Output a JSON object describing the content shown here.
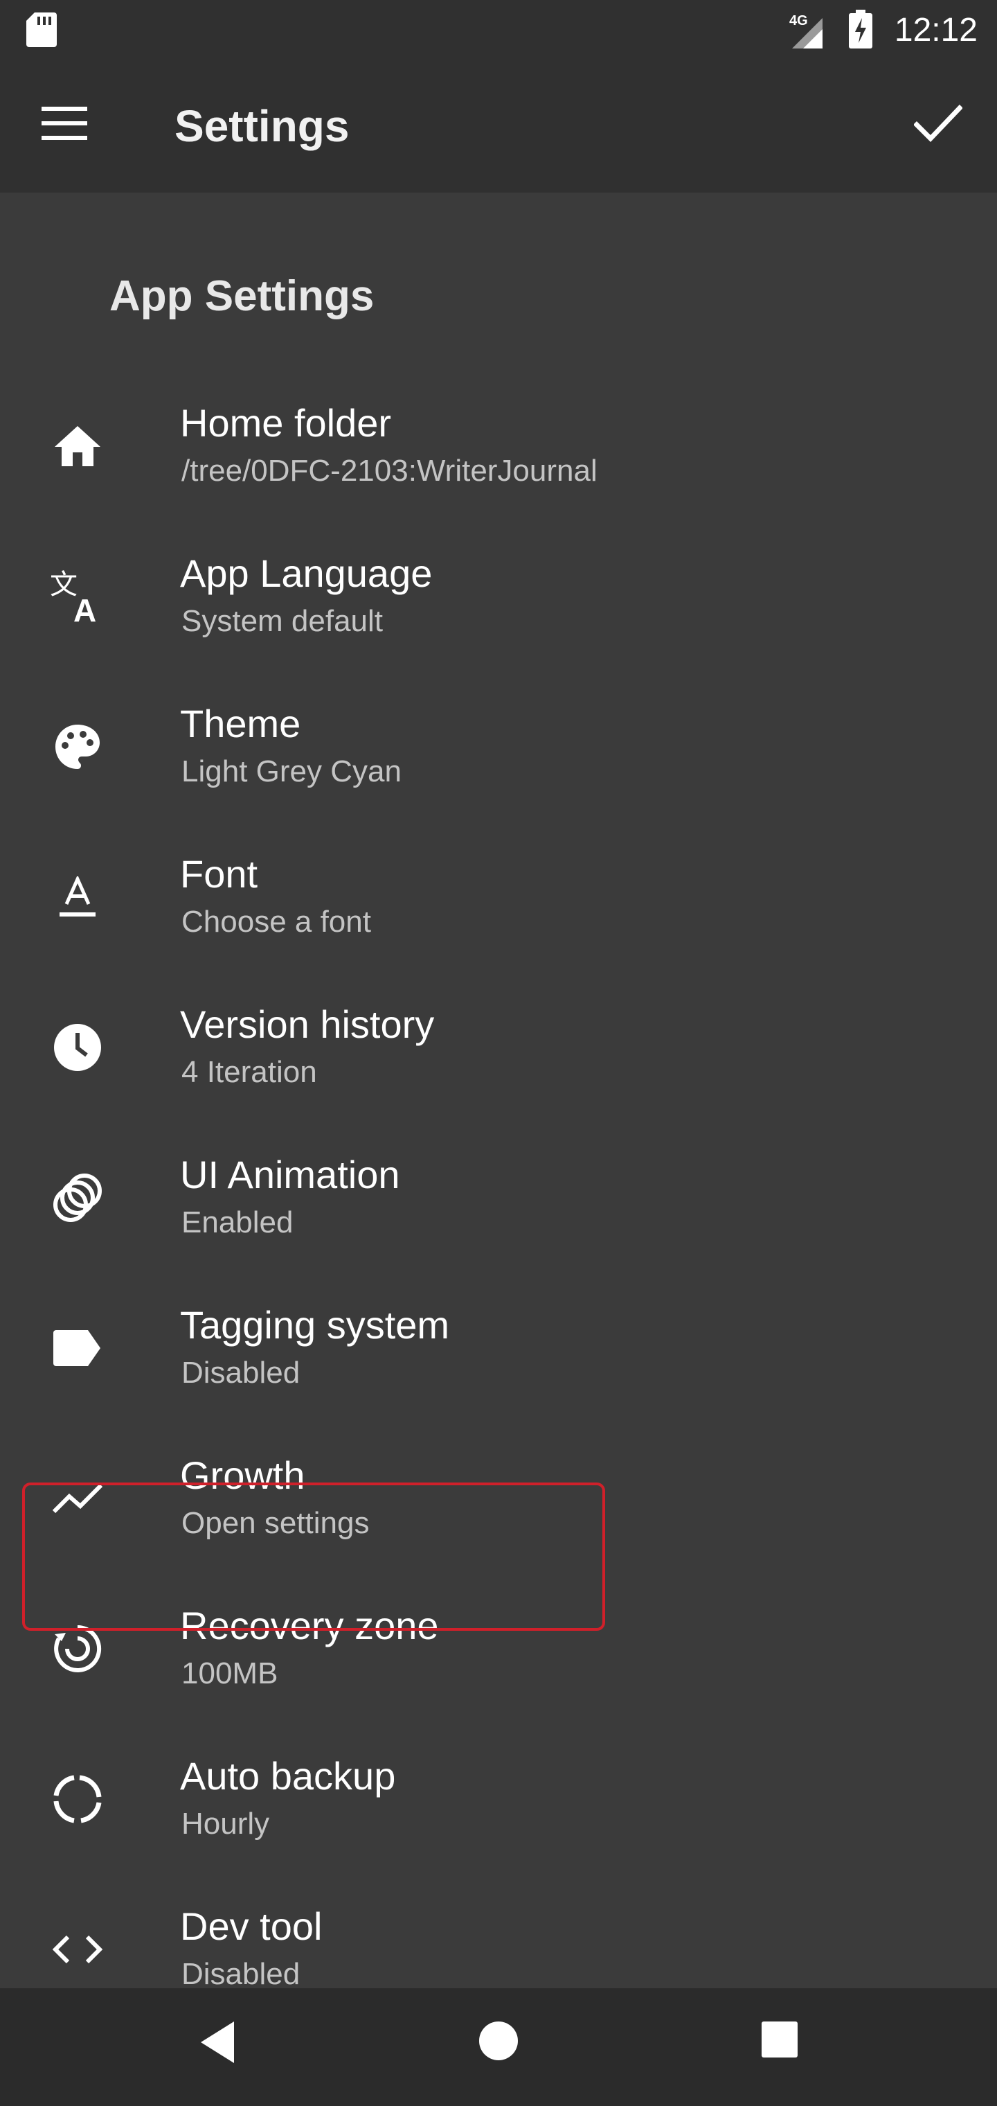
{
  "status_bar": {
    "time": "12:12",
    "network": "4G",
    "icons": [
      "sd-card-icon",
      "signal-icon",
      "battery-charging-icon"
    ]
  },
  "app_bar": {
    "title": "Settings",
    "menu_icon": "menu-icon",
    "confirm_icon": "check-icon"
  },
  "section": {
    "title": "App Settings"
  },
  "items": [
    {
      "id": "home-folder",
      "icon": "home-icon",
      "label": "Home folder",
      "summary": "/tree/0DFC-2103:WriterJournal"
    },
    {
      "id": "app-language",
      "icon": "translate-icon",
      "label": "App Language",
      "summary": "System default"
    },
    {
      "id": "theme",
      "icon": "palette-icon",
      "label": "Theme",
      "summary": "Light Grey Cyan"
    },
    {
      "id": "font",
      "icon": "font-icon",
      "label": "Font",
      "summary": "Choose a font"
    },
    {
      "id": "version-history",
      "icon": "clock-icon",
      "label": "Version history",
      "summary": "4 Iteration"
    },
    {
      "id": "ui-animation",
      "icon": "animation-icon",
      "label": "UI Animation",
      "summary": "Enabled"
    },
    {
      "id": "tagging-system",
      "icon": "tag-icon",
      "label": "Tagging system",
      "summary": "Disabled"
    },
    {
      "id": "growth",
      "icon": "trending-up-icon",
      "label": "Growth",
      "summary": "Open settings"
    },
    {
      "id": "recovery-zone",
      "icon": "restore-icon",
      "label": "Recovery zone",
      "summary": "100MB"
    },
    {
      "id": "auto-backup",
      "icon": "backup-progress-icon",
      "label": "Auto backup",
      "summary": "Hourly"
    },
    {
      "id": "dev-tool",
      "icon": "code-icon",
      "label": "Dev tool",
      "summary": "Disabled"
    }
  ],
  "highlighted_item": "tagging-system",
  "colors": {
    "background": "#3b3b3b",
    "bars": "#303030",
    "nav_bar": "#2b2b2b",
    "text_primary": "#ffffff",
    "text_secondary": "#c4c4c4",
    "highlight_border": "#d0202a"
  },
  "nav_bar": {
    "buttons": [
      "back-icon",
      "home-circle-icon",
      "recents-icon"
    ]
  }
}
